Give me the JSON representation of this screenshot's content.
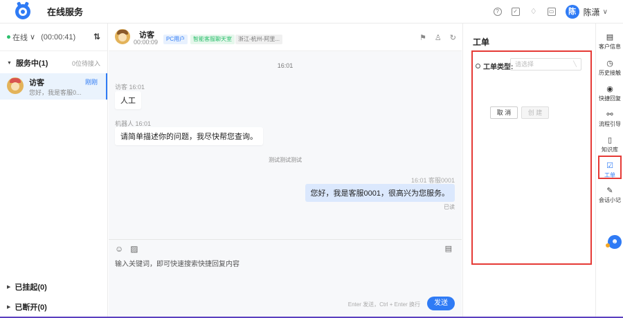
{
  "header": {
    "title": "在线服务",
    "user_avatar_text": "陈",
    "user_name": "陈潇",
    "icons": [
      "help-icon",
      "checkbox-icon",
      "bell-icon",
      "calendar-icon"
    ]
  },
  "left": {
    "status_label": "在线",
    "status_caret": "∨",
    "status_timer": "(00:00:41)",
    "sort_glyph": "⇅",
    "serving_group": {
      "label": "服务中(1)",
      "count": "0位待接入"
    },
    "conversations": [
      {
        "name": "访客",
        "preview": "您好，我是客服0...",
        "time": "刚刚"
      }
    ],
    "suspended_group": "已挂起(0)",
    "disconnected_group": "已断开(0)"
  },
  "chat": {
    "visitor_name": "访客",
    "visitor_timer": "00:00:09",
    "tags": [
      "PC用户",
      "智能客服聊天室",
      "浙江-杭州-阿里..."
    ],
    "messages": {
      "time_divider": "16:01",
      "m1_sender": "访客  16:01",
      "m1_text": "人工",
      "m2_sender": "机器人  16:01",
      "m2_text": "请简单描述你的问题，我尽快帮您查询。",
      "system_note": "测试测试测试",
      "agent_meta": "16:01  客服0001",
      "agent_text": "您好，我是客服0001，很高兴为您服务。",
      "read_status": "已读"
    },
    "composer": {
      "placeholder": "输入关键词，即可快速搜索快捷回复内容",
      "send_hint": "Enter 发送，Ctrl + Enter 换行",
      "send_label": "发送"
    }
  },
  "work_order": {
    "title": "工单",
    "type_label": "工单类型:",
    "type_placeholder": "请选择",
    "cancel_label": "取 消",
    "create_label": "创 建"
  },
  "tools": [
    {
      "label": "客户信息",
      "icon": "customer-info-icon"
    },
    {
      "label": "历史接触",
      "icon": "history-icon"
    },
    {
      "label": "快捷回复",
      "icon": "quick-reply-icon"
    },
    {
      "label": "流程引导",
      "icon": "flow-guide-icon"
    },
    {
      "label": "知识库",
      "icon": "knowledge-icon"
    },
    {
      "label": "工单",
      "icon": "work-order-icon",
      "active": true
    },
    {
      "label": "会话小记",
      "icon": "note-icon"
    }
  ],
  "colors": {
    "accent": "#2f7bf5",
    "highlight": "#e53935",
    "online": "#2bbf6c"
  }
}
